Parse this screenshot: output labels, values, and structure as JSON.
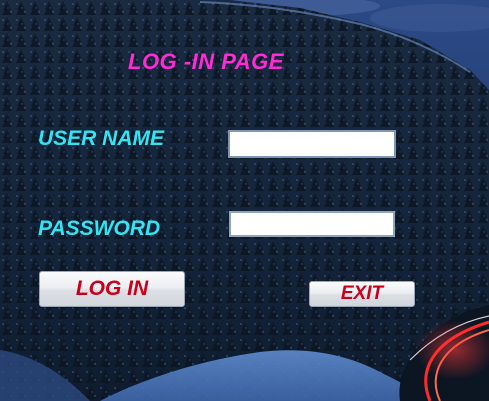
{
  "login_form": {
    "title": "LOG -IN PAGE",
    "username_label": "USER NAME",
    "username_value": "",
    "password_label": "PASSWORD",
    "password_value": "",
    "login_button_label": "LOG IN",
    "exit_button_label": "EXIT"
  },
  "colors": {
    "title": "#ff2bd6",
    "labels": "#33e5f2",
    "button_text": "#c8001a"
  }
}
